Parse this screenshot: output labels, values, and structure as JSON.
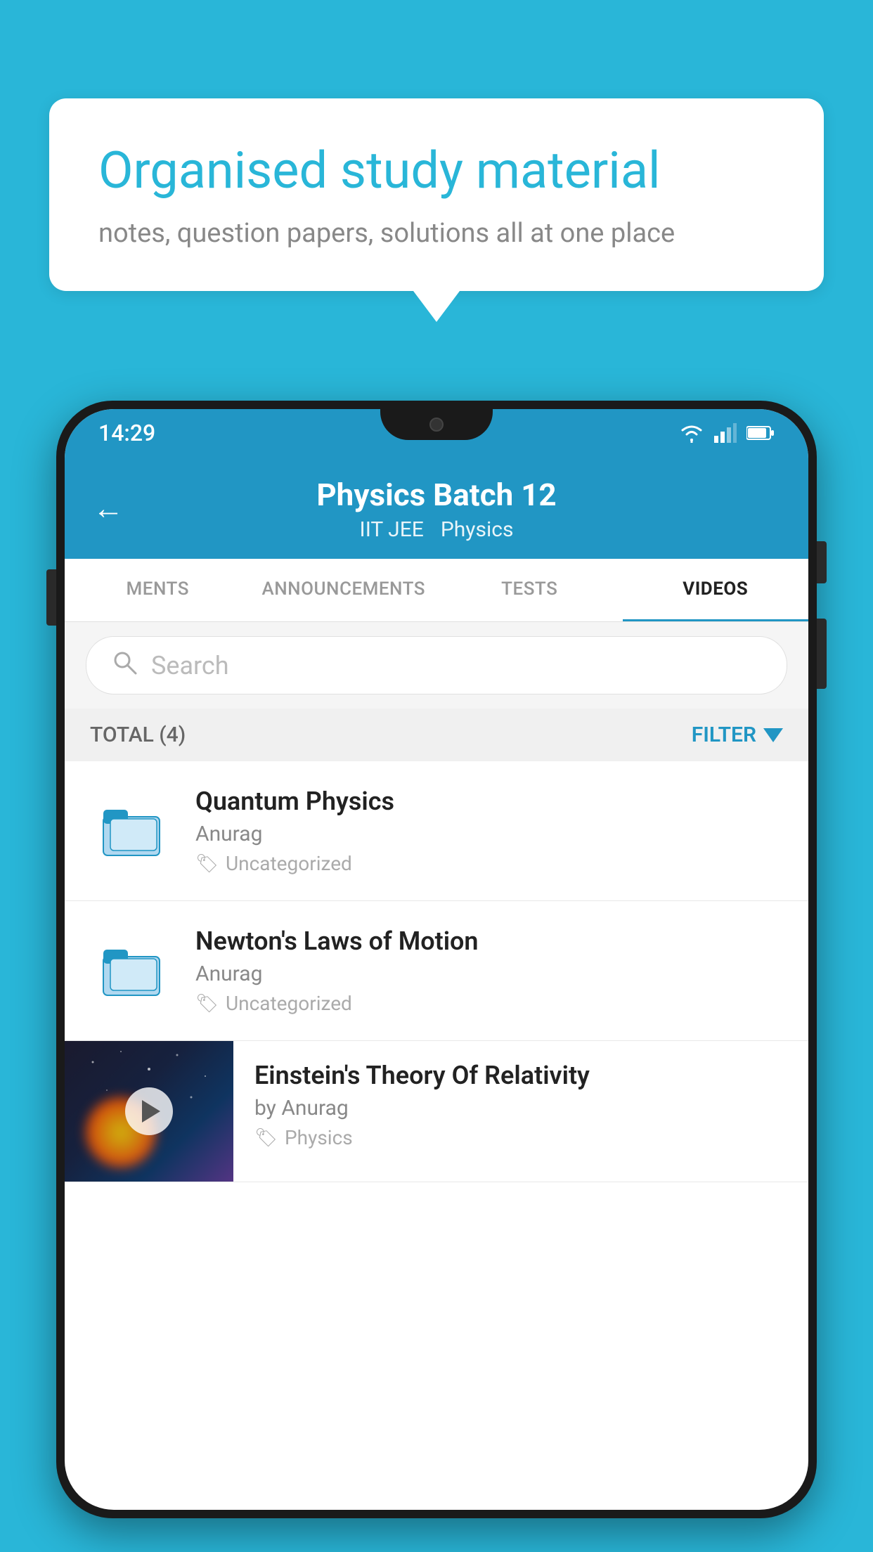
{
  "background": {
    "color": "#29b6d8"
  },
  "speech_bubble": {
    "title": "Organised study material",
    "subtitle": "notes, question papers, solutions all at one place"
  },
  "phone": {
    "status_bar": {
      "time": "14:29"
    },
    "header": {
      "back_label": "←",
      "title": "Physics Batch 12",
      "tag1": "IIT JEE",
      "tag2": "Physics"
    },
    "tabs": [
      {
        "label": "MENTS",
        "active": false
      },
      {
        "label": "ANNOUNCEMENTS",
        "active": false
      },
      {
        "label": "TESTS",
        "active": false
      },
      {
        "label": "VIDEOS",
        "active": true
      }
    ],
    "search": {
      "placeholder": "Search"
    },
    "filter": {
      "total_label": "TOTAL (4)",
      "filter_label": "FILTER"
    },
    "videos": [
      {
        "title": "Quantum Physics",
        "author": "Anurag",
        "tag": "Uncategorized",
        "type": "folder"
      },
      {
        "title": "Newton's Laws of Motion",
        "author": "Anurag",
        "tag": "Uncategorized",
        "type": "folder"
      },
      {
        "title": "Einstein's Theory Of Relativity",
        "author": "by Anurag",
        "tag": "Physics",
        "type": "video"
      }
    ]
  }
}
